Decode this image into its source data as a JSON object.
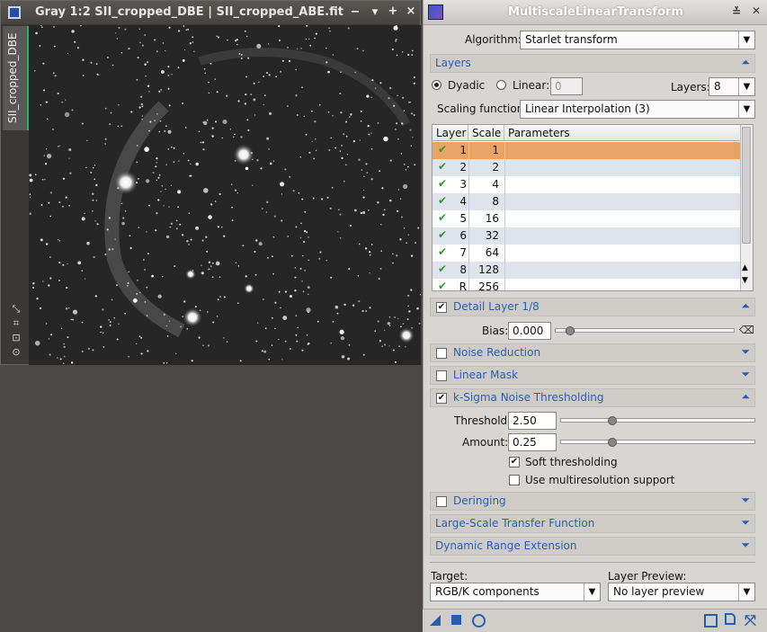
{
  "image_window": {
    "title": "Gray 1:2 SII_cropped_DBE | SII_cropped_ABE.fit",
    "side_tab_label": "SII_cropped_DBE",
    "buttons": {
      "minimize": "−",
      "shade": "▾",
      "maximize": "+",
      "close": "×"
    }
  },
  "panel": {
    "title": "MultiscaleLinearTransform",
    "algorithm_label": "Algorithm:",
    "algorithm_value": "Starlet transform",
    "layers_section": "Layers",
    "dyadic_label": "Dyadic",
    "linear_label": "Linear:",
    "linear_value": "0",
    "layers_label": "Layers:",
    "layers_value": "8",
    "scaling_label": "Scaling function:",
    "scaling_value": "Linear Interpolation (3)",
    "table": {
      "headers": [
        "Layer",
        "Scale",
        "Parameters"
      ],
      "rows": [
        {
          "layer": "1",
          "scale": "1"
        },
        {
          "layer": "2",
          "scale": "2"
        },
        {
          "layer": "3",
          "scale": "4"
        },
        {
          "layer": "4",
          "scale": "8"
        },
        {
          "layer": "5",
          "scale": "16"
        },
        {
          "layer": "6",
          "scale": "32"
        },
        {
          "layer": "7",
          "scale": "64"
        },
        {
          "layer": "8",
          "scale": "128"
        },
        {
          "layer": "R",
          "scale": "256"
        }
      ]
    },
    "detail_section": "Detail Layer 1/8",
    "bias_label": "Bias:",
    "bias_value": "0.000",
    "noise_reduction": "Noise Reduction",
    "linear_mask": "Linear Mask",
    "ksigma": "k-Sigma Noise Thresholding",
    "threshold_label": "Threshold:",
    "threshold_value": "2.50",
    "amount_label": "Amount:",
    "amount_value": "0.25",
    "soft_label": "Soft thresholding",
    "multires_label": "Use multiresolution support",
    "deringing": "Deringing",
    "lstf": "Large-Scale Transfer Function",
    "dre": "Dynamic Range Extension",
    "target_label": "Target:",
    "target_value": "RGB/K components",
    "preview_label": "Layer Preview:",
    "preview_value": "No layer preview"
  },
  "colors": {
    "selected_row": "#e8a464",
    "section_text": "#2a5db0",
    "check": "#2b9a2b"
  }
}
